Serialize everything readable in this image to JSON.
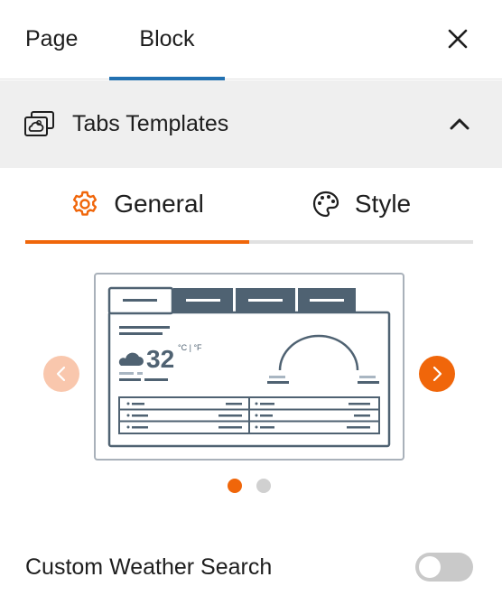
{
  "top_tabs": {
    "page": "Page",
    "block": "Block",
    "active": "Block"
  },
  "panel": {
    "title": "Tabs Templates",
    "expanded": true
  },
  "sub_tabs": {
    "general": "General",
    "style": "Style",
    "active": "General"
  },
  "template_preview": {
    "temperature": "32",
    "units": "°C | °F",
    "tab_count": 4
  },
  "carousel": {
    "current_slide": 1,
    "total_slides": 2
  },
  "settings": {
    "custom_weather_search": {
      "label": "Custom Weather Search",
      "enabled": false
    }
  },
  "colors": {
    "accent": "#f0660a",
    "accent_light": "#f9c7ad",
    "wp_blue": "#2271b1",
    "preview_slate": "#4f6272",
    "panel_bg": "#efefef"
  },
  "icons": {
    "close": "close-icon",
    "panel": "weather-template-icon",
    "collapse": "chevron-up-icon",
    "general": "gear-icon",
    "style": "palette-icon",
    "prev": "chevron-left-icon",
    "next": "chevron-right-icon"
  }
}
